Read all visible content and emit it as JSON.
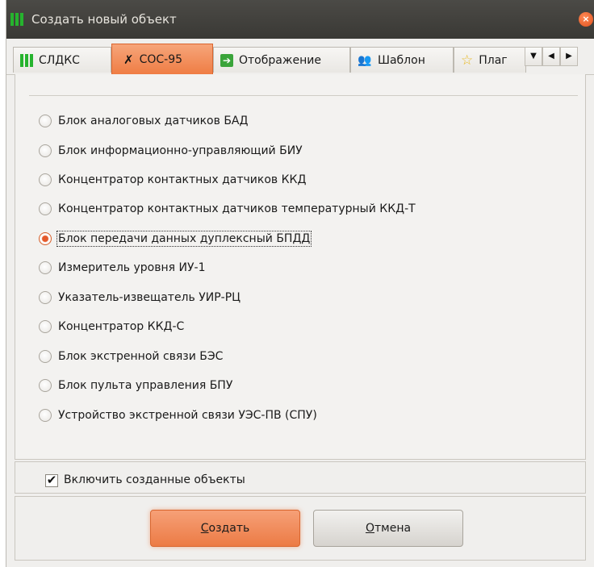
{
  "window": {
    "title": "Создать новый объект",
    "close_glyph": "×"
  },
  "tabs": [
    {
      "label": "СЛДКС",
      "icon": "sldks-icon",
      "active": false
    },
    {
      "label": "СОС-95",
      "icon": "antenna-icon",
      "active": true
    },
    {
      "label": "Отображение",
      "icon": "arrow-right-icon",
      "active": false
    },
    {
      "label": "Шаблон",
      "icon": "people-icon",
      "active": false
    },
    {
      "label": "Плаг",
      "icon": "star-icon",
      "active": false
    }
  ],
  "tab_scroll": {
    "menu": "▼",
    "left": "◀",
    "right": "▶"
  },
  "object_types": {
    "selected_index": 4,
    "options": [
      "Блок аналоговых датчиков БАД",
      "Блок информационно-управляющий БИУ",
      "Концентратор контактных датчиков ККД",
      "Концентратор контактных датчиков температурный ККД-Т",
      "Блок передачи данных дуплексный БПДД",
      "Измеритель уровня ИУ-1",
      "Указатель-извещатель УИР-РЦ",
      "Концентратор ККД-С",
      "Блок экстренной связи БЭС",
      "Блок пульта управления БПУ",
      "Устройство экстренной связи УЭС-ПВ (СПУ)"
    ]
  },
  "enable_created": {
    "label": "Включить созданные объекты",
    "checked": true,
    "mark": "✔"
  },
  "buttons": {
    "create_mnemonic": "С",
    "create_rest": "оздать",
    "cancel_mnemonic": "О",
    "cancel_rest": "тмена"
  },
  "colors": {
    "accent": "#ef7d44",
    "titlebar": "#3c3b37",
    "brand_green": "#26b32e"
  }
}
